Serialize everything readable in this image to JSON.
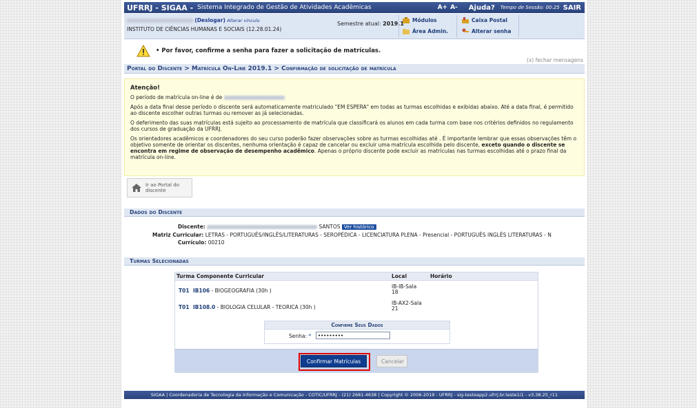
{
  "topbar": {
    "system_name": "UFRRJ - SIGAA -",
    "system_description": "Sistema Integrado de Gestão de Atividades Acadêmicas",
    "font_increase": "A+",
    "font_decrease": "A-",
    "help": "Ajuda?",
    "session_label": "Tempo de Sessão: 00:25",
    "logout": "SAIR"
  },
  "userbar": {
    "logout_small": "(Deslogar)",
    "change_bond": "Alterar vínculo",
    "institute": "INSTITUTO DE CIÊNCIAS HUMANAS E SOCIAIS (12.28.01.24)",
    "semester_label": "Semestre atual:",
    "semester_value": "2019.1",
    "modules": "Módulos",
    "admin_area": "Área Admin.",
    "mailbox": "Caixa Postal",
    "change_password": "Alterar senha"
  },
  "message": {
    "text": "• Por favor, confirme a senha para fazer a solicitação de matrículas.",
    "close": "(x) fechar mensagens"
  },
  "breadcrumb": "Portal do Discente > Matrícula On-Line 2019.1 > Confirmação de solicitação de matrícula",
  "attention": {
    "title": "Atenção!",
    "p1": "O período de matrícula on-line é de",
    "p2": "Após a data final desse período o discente será automaticamente matriculado \"EM ESPERA\" em todas as turmas escolhidas e exibidas abaixo. Até a data final, é permitido ao discente escolher outras turmas ou remover as já selecionadas.",
    "p3": "O deferimento das suas matrículas está sujeito ao processamento de matrícula que classificará os alunos em cada turma com base nos critérios definidos no regulamento dos cursos de graduação da UFRRJ.",
    "p4a": "Os orientadores acadêmicos e coordenadores do seu curso poderão fazer observações sobre as turmas escolhidas até . É importante lembrar que essas observações têm o objetivo somente de orientar os discentes, nenhuma orientação é capaz de cancelar ou excluir uma matrícula escolhida pelo discente,",
    "p4b": "exceto quando o discente se encontra em regime de observação de desempenho acadêmico",
    "p4c": ". Apenas o próprio discente pode excluir as matrículas nas turmas escolhidas até o prazo final da matrícula on-line."
  },
  "portal_button": "Ir ao Portal do discente",
  "dados": {
    "header": "Dados do Discente",
    "discente_label": "Discente:",
    "discente_surname": "SANTOS",
    "historico_button": "Ver histórico",
    "matriz_label": "Matriz Curricular:",
    "matriz_value": "LETRAS - PORTUGUÊS/INGLÊS/LITERATURAS - SEROPÉDICA - LICENCIATURA PLENA - Presencial - PORTUGUÊS INGLÊS LITERATURAS - N",
    "curriculo_label": "Currículo:",
    "curriculo_value": "00210"
  },
  "turmas": {
    "header": "Turmas Selecionadas",
    "columns": [
      "Turma",
      "Componente Curricular",
      "Local",
      "Horário"
    ],
    "rows": [
      {
        "turma": "T01",
        "code": "IB106",
        "name": "- BIOGEOGRAFIA (30h )",
        "local1": "IB-IB-Sala",
        "local2": "18"
      },
      {
        "turma": "T01",
        "code": "IB108.0",
        "name": "- BIOLOGIA CELULAR - TEORICA (30h )",
        "local1": "IB-AX2-Sala",
        "local2": "21"
      }
    ]
  },
  "confirm": {
    "title": "Confirme Seus Dados",
    "senha_label": "Senha:",
    "required": "*",
    "password_value": "•••••••••",
    "confirm_button": "Confirmar Matrículas",
    "cancel_button": "Cancelar"
  },
  "footer": "SIGAA | Coordenadoria de Tecnologia da Informação e Comunicação - COTIC/UFRRJ - (21) 2681-4638 | Copyright © 2006-2019 - UFRRJ - sig-testeapp2.ufrrj.br.teste1i1 - v3.38.25_r11",
  "colors": {
    "header_blue": "#2a437a",
    "highlight_red": "#e00000",
    "confirm_blue": "#0f3d8f",
    "attention_bg": "#fefde0"
  }
}
